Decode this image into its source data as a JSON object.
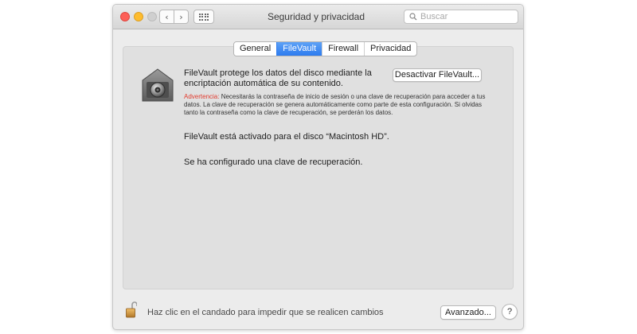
{
  "window": {
    "title": "Seguridad y privacidad"
  },
  "toolbar": {
    "back_icon": "‹",
    "forward_icon": "›",
    "search_placeholder": "Buscar",
    "search_value": ""
  },
  "tabs": [
    {
      "label": "General",
      "active": false
    },
    {
      "label": "FileVault",
      "active": true
    },
    {
      "label": "Firewall",
      "active": false
    },
    {
      "label": "Privacidad",
      "active": false
    }
  ],
  "filevault": {
    "description": "FileVault protege los datos del disco mediante la encriptación automática de su contenido.",
    "disable_button": "Desactivar FileVault...",
    "warning_label": "Advertencia:",
    "warning_text": " Necesitarás la contraseña de inicio de sesión o una clave de recuperación para acceder a tus datos. La clave de recuperación se genera automáticamente como parte de esta configuración. Si olvidas tanto la contraseña como la clave de recuperación, se perderán los datos.",
    "status_enabled": "FileVault está activado para el disco “Macintosh HD”.",
    "status_recovery_key": "Se ha configurado una clave de recuperación."
  },
  "footer": {
    "lock_text": "Haz clic en el candado para impedir que se realicen cambios",
    "advanced_button": "Avanzado...",
    "help_label": "?"
  },
  "colors": {
    "accent": "#2d7bef",
    "warning": "#e23b2e"
  },
  "icons": {
    "vault": "filevault-safe-icon",
    "lock": "padlock-open-icon",
    "search": "search-icon"
  }
}
